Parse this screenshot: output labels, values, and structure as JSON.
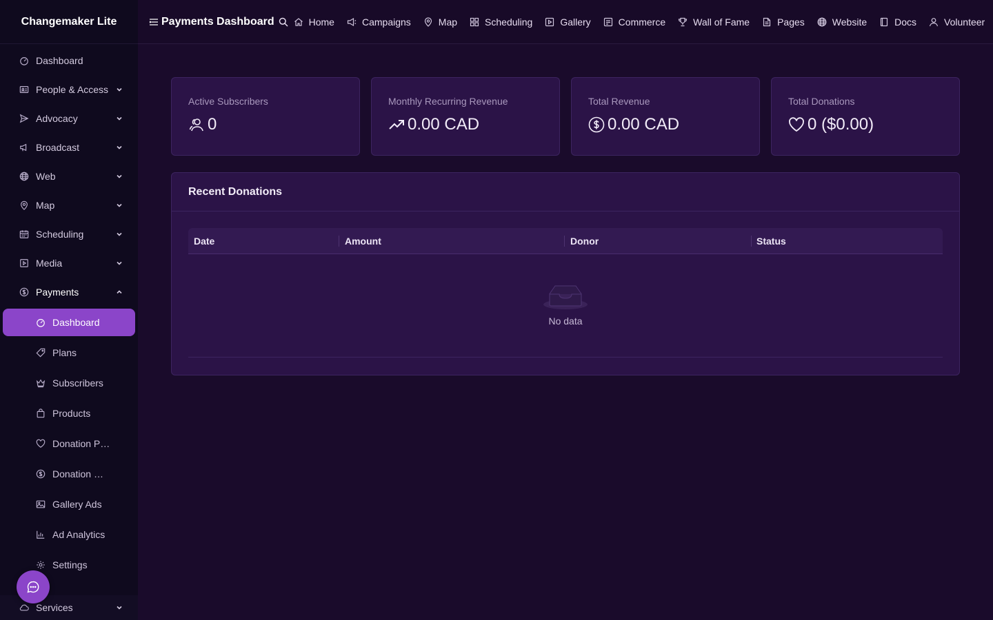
{
  "app": {
    "brand": "Changemaker Lite"
  },
  "header": {
    "title": "Payments Dashboard",
    "nav": [
      {
        "label": "Home",
        "icon": "home-icon"
      },
      {
        "label": "Campaigns",
        "icon": "megaphone-icon"
      },
      {
        "label": "Map",
        "icon": "map-pin-icon"
      },
      {
        "label": "Scheduling",
        "icon": "grid-icon"
      },
      {
        "label": "Gallery",
        "icon": "play-square-icon"
      },
      {
        "label": "Commerce",
        "icon": "storefront-icon"
      },
      {
        "label": "Wall of Fame",
        "icon": "trophy-icon"
      },
      {
        "label": "Pages",
        "icon": "file-icon"
      },
      {
        "label": "Website",
        "icon": "globe-icon"
      },
      {
        "label": "Docs",
        "icon": "book-icon"
      },
      {
        "label": "Volunteer",
        "icon": "user-icon"
      }
    ]
  },
  "sidebar": {
    "items": [
      {
        "label": "Dashboard",
        "icon": "dashboard-icon"
      },
      {
        "label": "People & Access",
        "icon": "id-card-icon"
      },
      {
        "label": "Advocacy",
        "icon": "send-icon"
      },
      {
        "label": "Broadcast",
        "icon": "megaphone-icon"
      },
      {
        "label": "Web",
        "icon": "globe-icon"
      },
      {
        "label": "Map",
        "icon": "map-pin-icon"
      },
      {
        "label": "Scheduling",
        "icon": "calendar-icon"
      },
      {
        "label": "Media",
        "icon": "play-square-icon"
      },
      {
        "label": "Payments",
        "icon": "dollar-circle-icon"
      }
    ],
    "payments_sub": [
      {
        "label": "Dashboard",
        "icon": "dashboard-icon"
      },
      {
        "label": "Plans",
        "icon": "tag-icon"
      },
      {
        "label": "Subscribers",
        "icon": "crown-icon"
      },
      {
        "label": "Products",
        "icon": "shopping-bag-icon"
      },
      {
        "label": "Donation Pages",
        "icon": "heart-icon"
      },
      {
        "label": "Donation Orders",
        "icon": "dollar-circle-icon"
      },
      {
        "label": "Gallery Ads",
        "icon": "image-icon"
      },
      {
        "label": "Ad Analytics",
        "icon": "bar-chart-icon"
      },
      {
        "label": "Settings",
        "icon": "gear-icon"
      }
    ],
    "services": {
      "label": "Services",
      "icon": "cloud-icon"
    }
  },
  "stats": [
    {
      "title": "Active Subscribers",
      "value": "0",
      "icon": "users-icon"
    },
    {
      "title": "Monthly Recurring Revenue",
      "value": "0.00 CAD",
      "icon": "trend-up-icon"
    },
    {
      "title": "Total Revenue",
      "value": "0.00 CAD",
      "icon": "dollar-circle-icon"
    },
    {
      "title": "Total Donations",
      "value": "0 ($0.00)",
      "icon": "heart-icon"
    }
  ],
  "recent_donations": {
    "title": "Recent Donations",
    "columns": [
      "Date",
      "Amount",
      "Donor",
      "Status"
    ],
    "empty_text": "No data"
  },
  "colors": {
    "accent": "#8b45c9",
    "background": "#1a0b2b",
    "sidebar": "#0f0a1e",
    "card": "#2b1347"
  }
}
